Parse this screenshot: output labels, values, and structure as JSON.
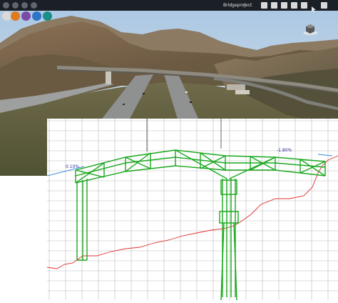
{
  "toolbar": {
    "project_name": "Bridgeproject",
    "dropdown_glyph": "▾",
    "left_icons": [
      "home-icon",
      "back-icon",
      "settings-icon",
      "help-icon"
    ],
    "right_icons": [
      "list-icon",
      "grid-icon",
      "document-icon",
      "share-icon",
      "info-icon",
      "pointer-icon",
      "expand-icon"
    ]
  },
  "layer_buttons": [
    {
      "name": "layer-orange",
      "color": "#e07a1f"
    },
    {
      "name": "layer-purple",
      "color": "#7a4aa8"
    },
    {
      "name": "layer-blue",
      "color": "#2f74c8"
    },
    {
      "name": "layer-teal",
      "color": "#1a8f8a"
    }
  ],
  "profile": {
    "left_slope": "0.10%",
    "right_slope": "-1.80%",
    "truss_color": "#19a81c",
    "terrain_color": "#e03030",
    "grade_line_color": "#3a8fd8"
  }
}
